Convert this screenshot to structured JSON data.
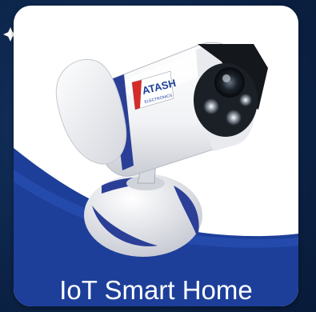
{
  "app_icon": {
    "title": "IoT Smart Home",
    "brand_text": "ATASH",
    "brand_subtext": "ELECTRONICS",
    "icon": "security-camera-icon",
    "colors": {
      "background": "#0b2146",
      "card": "#ffffff",
      "accent_blue": "#1d3f9a",
      "brand_red": "#d42a2a"
    }
  }
}
